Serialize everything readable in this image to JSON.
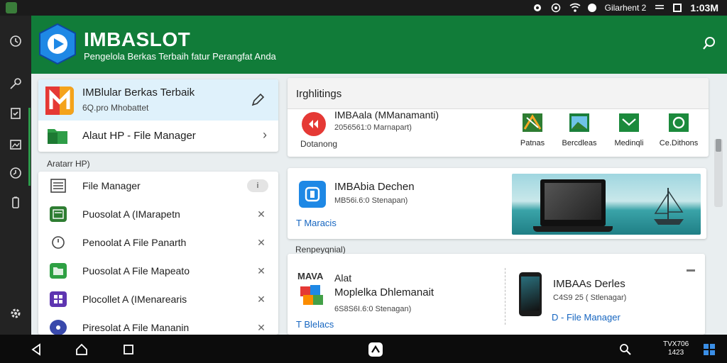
{
  "status_bar": {
    "carrier_text": "Gilarhent 2",
    "time": "1:03M"
  },
  "header": {
    "title": "IMBASLOT",
    "subtitle": "Pengelola Berkas Terbaih fatur Perangfat Anda"
  },
  "featured": {
    "title": "IMBlular Berkas Terbaik",
    "subtitle": "6Q.pro Mhobattet",
    "bottom_label": "Alaut HP - File Manager"
  },
  "section_label_left": "Aratarr HP)",
  "left_list": [
    {
      "label": "File Manager",
      "trailing": "pill",
      "pill_text": "i"
    },
    {
      "label": "Puosolat A (IMarapetn",
      "trailing": "x",
      "x_text": "✕"
    },
    {
      "label": "Penoolat A File Panarth",
      "trailing": "x",
      "x_text": "✕"
    },
    {
      "label": "Puosolat A File Mapeato",
      "trailing": "x",
      "x_text": "✕"
    },
    {
      "label": "Plocollet A (IMenarearis",
      "trailing": "x",
      "x_text": "✕"
    },
    {
      "label": "Piresolat A File Mananin",
      "trailing": "x",
      "x_text": "✕"
    }
  ],
  "highlights": {
    "title": "Irghlitings",
    "item_title": "IMBAala (MManamanti)",
    "item_subtitle": "2056561:0 Marnapart)",
    "item_caption": "Dotanong",
    "categories": [
      "Patnas",
      "Bercdleas",
      "Medinqli",
      "Ce.Dithons"
    ]
  },
  "promo": {
    "title": "IMBAbia Dechen",
    "subtitle": "MB56i.6:0 Stenapan)",
    "link": "T Maracis"
  },
  "recommend_label": "Renpeyqnial)",
  "bottom_card": {
    "logo_text": "MAVA",
    "line1": "Alat",
    "title": "Moplelka Dhlemanait",
    "subtitle": "6S8S6I.6:0 Stenagan)",
    "link": "T Blelacs",
    "right_title": "IMBAAs Derles",
    "right_subtitle": "C4S9 25 ( Stlenagar)",
    "right_link": "D - File Manager"
  },
  "nav": {
    "time_line1": "TVX706",
    "time_line2": "1423"
  },
  "colors": {
    "header_green": "#117c39",
    "accent_green": "#2c9a4a",
    "link_blue": "#1565c0"
  }
}
